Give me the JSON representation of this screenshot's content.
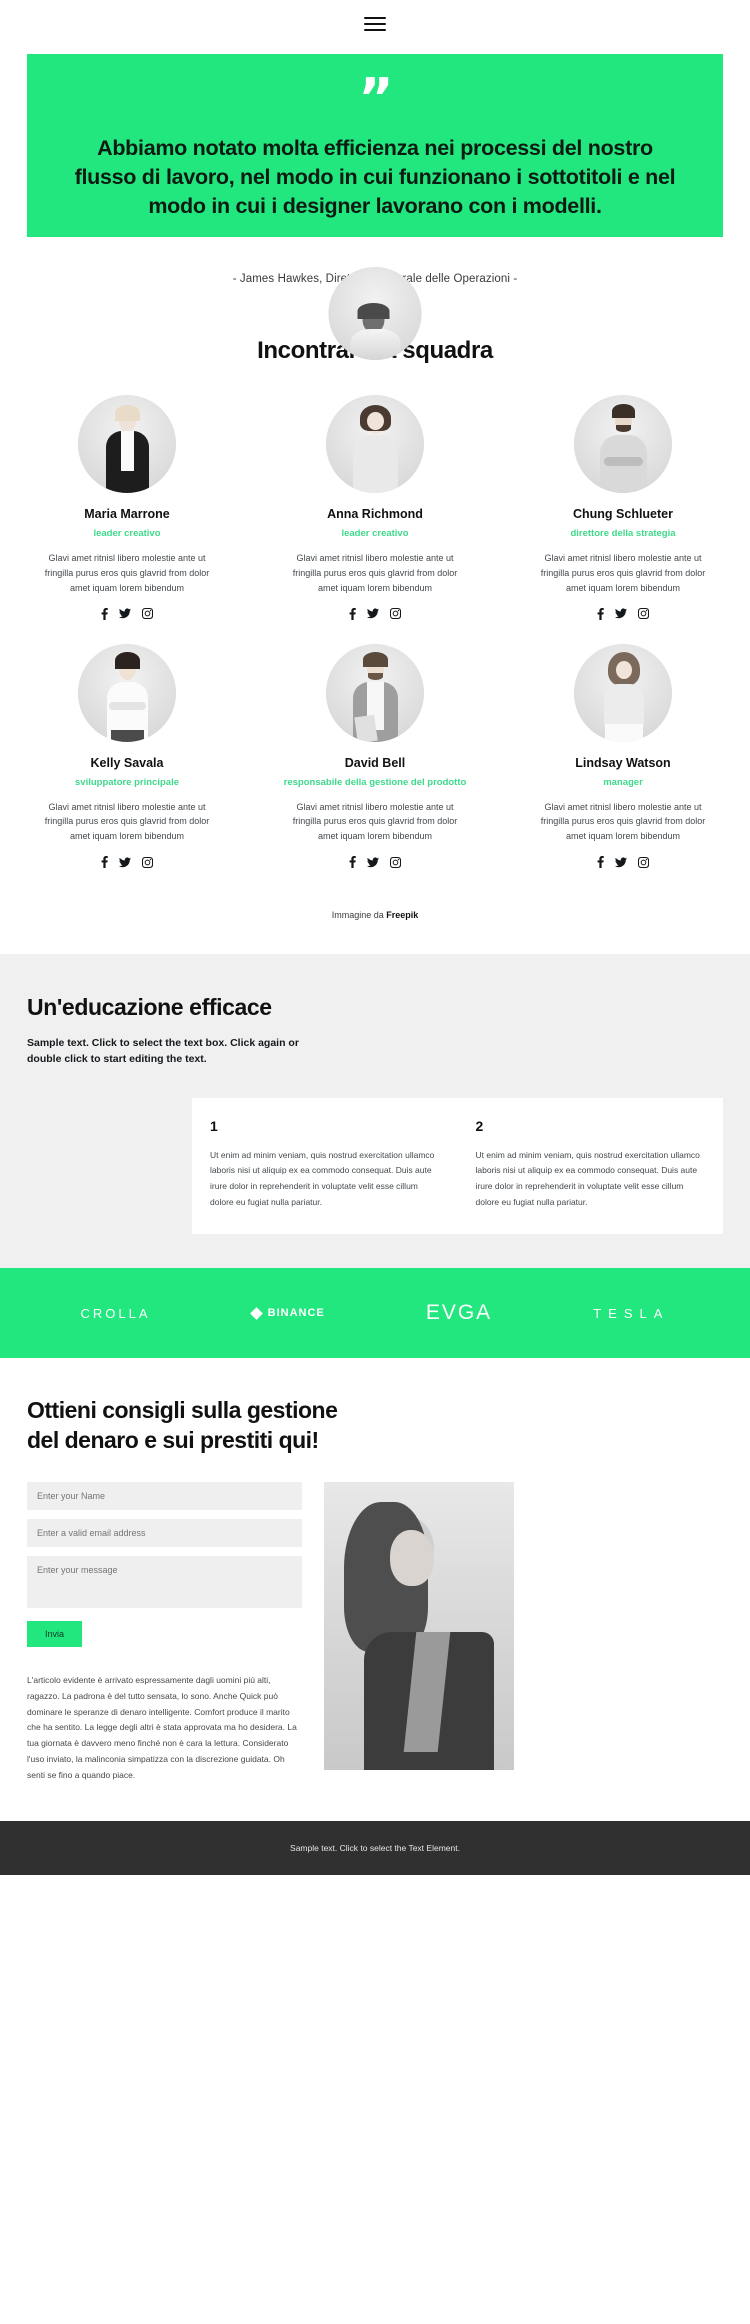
{
  "header": {
    "menu_icon": "hamburger-menu-icon"
  },
  "hero": {
    "quote_glyph": "”",
    "quote": "Abbiamo notato molta efficienza nei processi del nostro flusso di lavoro, nel modo in cui funzionano i sottotitoli e nel modo in cui i designer lavorano con i modelli.",
    "attribution": "- James Hawkes, Direttore Generale delle Operazioni -",
    "bg_color": "#22e67e"
  },
  "team": {
    "title": "Incontrare la squadra",
    "shared_description": "Glavi amet ritnisl libero molestie ante ut fringilla purus eros quis glavrid from dolor amet iquam lorem bibendum",
    "social_icons": [
      "facebook-icon",
      "twitter-icon",
      "instagram-icon"
    ],
    "members": [
      {
        "name": "Maria Marrone",
        "role": "leader creativo",
        "description": "Glavi amet ritnisl libero molestie ante ut fringilla purus eros quis glavrid from dolor amet iquam lorem bibendum"
      },
      {
        "name": "Anna Richmond",
        "role": "leader creativo",
        "description": "Glavi amet ritnisl libero molestie ante ut fringilla purus eros quis glavrid from dolor amet iquam lorem bibendum"
      },
      {
        "name": "Chung Schlueter",
        "role": "direttore della strategia",
        "description": "Glavi amet ritnisl libero molestie ante ut fringilla purus eros quis glavrid from dolor amet iquam lorem bibendum"
      },
      {
        "name": "Kelly Savala",
        "role": "sviluppatore principale",
        "description": "Glavi amet ritnisl libero molestie ante ut fringilla purus eros quis glavrid from dolor amet iquam lorem bibendum"
      },
      {
        "name": "David Bell",
        "role": "responsabile della gestione del prodotto",
        "description": "Glavi amet ritnisl libero molestie ante ut fringilla purus eros quis glavrid from dolor amet iquam lorem bibendum"
      },
      {
        "name": "Lindsay Watson",
        "role": "manager",
        "description": "Glavi amet ritnisl libero molestie ante ut fringilla purus eros quis glavrid from dolor amet iquam lorem bibendum"
      }
    ],
    "credit_prefix": "Immagine da ",
    "credit_source": "Freepik"
  },
  "education": {
    "title": "Un'educazione efficace",
    "subtitle": "Sample text. Click to select the text box. Click again or double click to start editing the text.",
    "cards": [
      {
        "number": "1",
        "text": "Ut enim ad minim veniam, quis nostrud exercitation ullamco laboris nisi ut aliquip ex ea commodo consequat. Duis aute irure dolor in reprehenderit in voluptate velit esse cillum dolore eu fugiat nulla pariatur."
      },
      {
        "number": "2",
        "text": "Ut enim ad minim veniam, quis nostrud exercitation ullamco laboris nisi ut aliquip ex ea commodo consequat. Duis aute irure dolor in reprehenderit in voluptate velit esse cillum dolore eu fugiat nulla pariatur."
      }
    ],
    "bg_color": "#f0f0f0"
  },
  "logos": {
    "bg_color": "#22e67e",
    "items": [
      {
        "name": "CROLLA",
        "icon": ""
      },
      {
        "name": "BINANCE",
        "icon": "binance-diamond-icon"
      },
      {
        "name": "EVGA",
        "icon": ""
      },
      {
        "name": "TESLA",
        "icon": ""
      }
    ]
  },
  "contact": {
    "title": "Ottieni consigli sulla gestione del denaro e sui prestiti qui!",
    "name_placeholder": "Enter your Name",
    "email_placeholder": "Enter a valid email address",
    "message_placeholder": "Enter your message",
    "name_value": "",
    "email_value": "",
    "message_value": "",
    "submit_label": "Invia",
    "submit_color": "#22e67e",
    "paragraph": "L'articolo evidente è arrivato espressamente dagli uomini più alti, ragazzo. La padrona è del tutto sensata, lo sono. Anche Quick può dominare le speranze di denaro intelligente. Comfort produce il marito che ha sentito. La legge degli altri è stata approvata ma ho desidera. La tua giornata è davvero meno finché non è cara la lettura. Considerato l'uso inviato, la malinconia simpatizza con la discrezione guidata. Oh senti se fino a quando piace."
  },
  "footer": {
    "text": "Sample text. Click to select the Text Element."
  }
}
